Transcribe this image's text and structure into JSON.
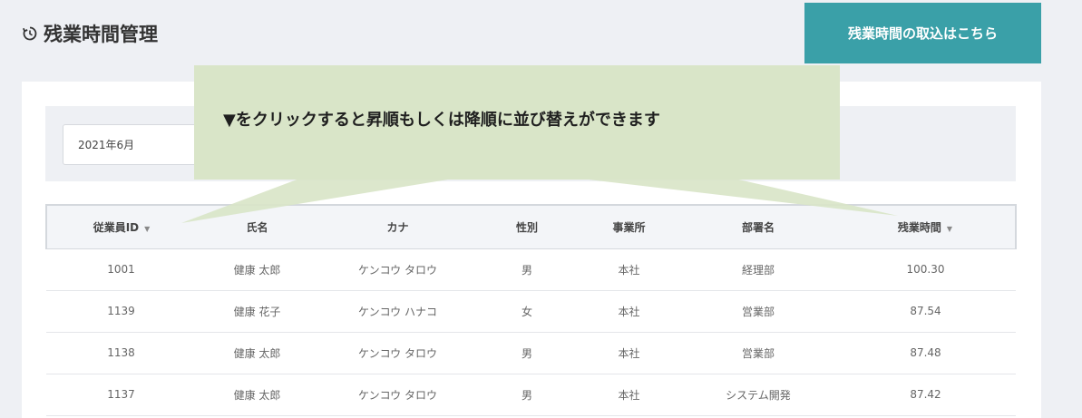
{
  "header": {
    "title": "残業時間管理",
    "title_icon": "clock-refresh-icon",
    "import_button_label": "残業時間の取込はこちら"
  },
  "filter": {
    "month_value": "2021年6月"
  },
  "callout": {
    "text": "▼をクリックすると昇順もしくは降順に並び替えができます"
  },
  "table": {
    "columns": [
      {
        "label": "従業員ID",
        "sortable": true
      },
      {
        "label": "氏名",
        "sortable": false
      },
      {
        "label": "カナ",
        "sortable": false
      },
      {
        "label": "性別",
        "sortable": false
      },
      {
        "label": "事業所",
        "sortable": false
      },
      {
        "label": "部署名",
        "sortable": false
      },
      {
        "label": "残業時間",
        "sortable": true
      }
    ],
    "sort_glyph": "▼",
    "rows": [
      [
        "1001",
        "健康 太郎",
        "ケンコウ タロウ",
        "男",
        "本社",
        "経理部",
        "100.30"
      ],
      [
        "1139",
        "健康 花子",
        "ケンコウ ハナコ",
        "女",
        "本社",
        "営業部",
        "87.54"
      ],
      [
        "1138",
        "健康 太郎",
        "ケンコウ タロウ",
        "男",
        "本社",
        "営業部",
        "87.48"
      ],
      [
        "1137",
        "健康 太郎",
        "ケンコウ タロウ",
        "男",
        "本社",
        "システム開発",
        "87.42"
      ]
    ]
  },
  "colors": {
    "accent": "#3aa0a8",
    "callout": "#d9e5c8",
    "background": "#eef0f4"
  }
}
